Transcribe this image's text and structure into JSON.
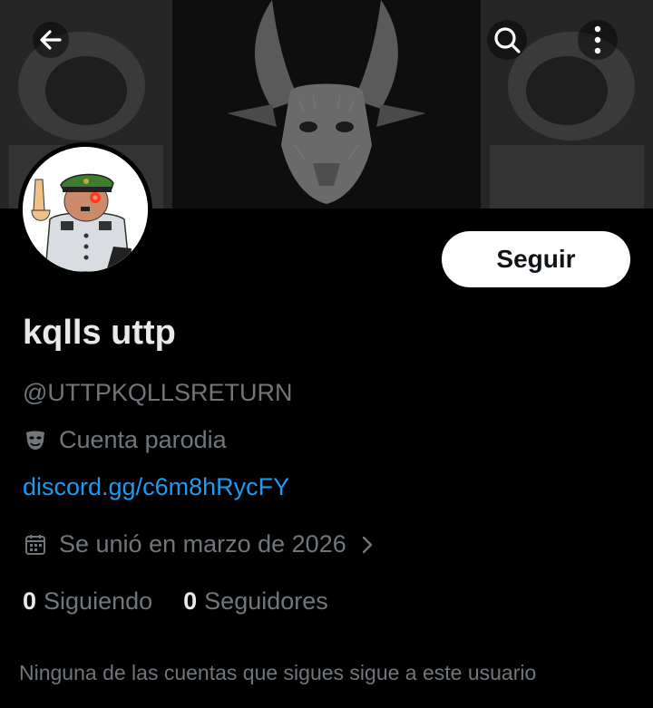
{
  "header": {
    "back_icon": "arrow-left-icon",
    "search_icon": "search-icon",
    "more_icon": "more-vertical-icon"
  },
  "profile": {
    "display_name": "kqlls uttp",
    "handle": "@UTTPKQLLSRETURN",
    "parody_icon": "theater-mask-icon",
    "parody_label": "Cuenta parodia",
    "link": "discord.gg/c6m8hRycFY",
    "joined_icon": "calendar-icon",
    "joined": "Se unió en marzo de 2026",
    "follow_label": "Seguir"
  },
  "stats": {
    "following_count": "0",
    "following_label": "Siguiendo",
    "followers_count": "0",
    "followers_label": "Seguidores"
  },
  "note": "Ninguna de las cuentas que sigues sigue a este usuario",
  "colors": {
    "background": "#000000",
    "text_primary": "#e7e9ea",
    "text_secondary": "#71767b",
    "link": "#1d9bf0",
    "button_bg": "#ffffff"
  }
}
